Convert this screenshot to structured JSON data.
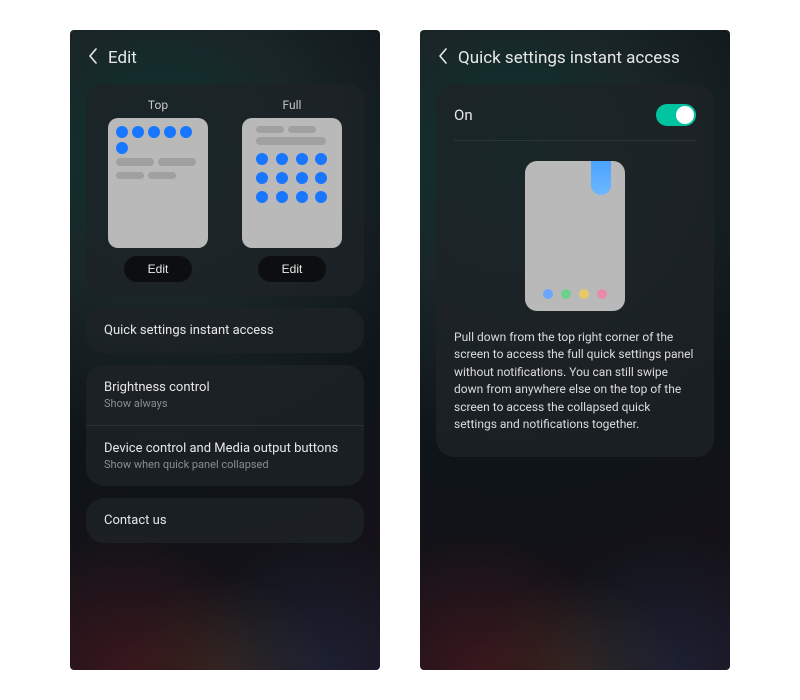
{
  "left": {
    "title": "Edit",
    "preview": {
      "top_label": "Top",
      "full_label": "Full",
      "edit_label": "Edit"
    },
    "rows": {
      "instant_access": "Quick settings instant access",
      "brightness_title": "Brightness control",
      "brightness_sub": "Show always",
      "device_title": "Device control and Media output buttons",
      "device_sub": "Show when quick panel collapsed",
      "contact": "Contact us"
    }
  },
  "right": {
    "title": "Quick settings instant access",
    "toggle_label": "On",
    "toggle_state": true,
    "description": "Pull down from the top right corner of the screen to access the full quick settings panel without notifications. You can still swipe down from anywhere else on the top of the screen to access the collapsed quick settings and notifications together."
  }
}
